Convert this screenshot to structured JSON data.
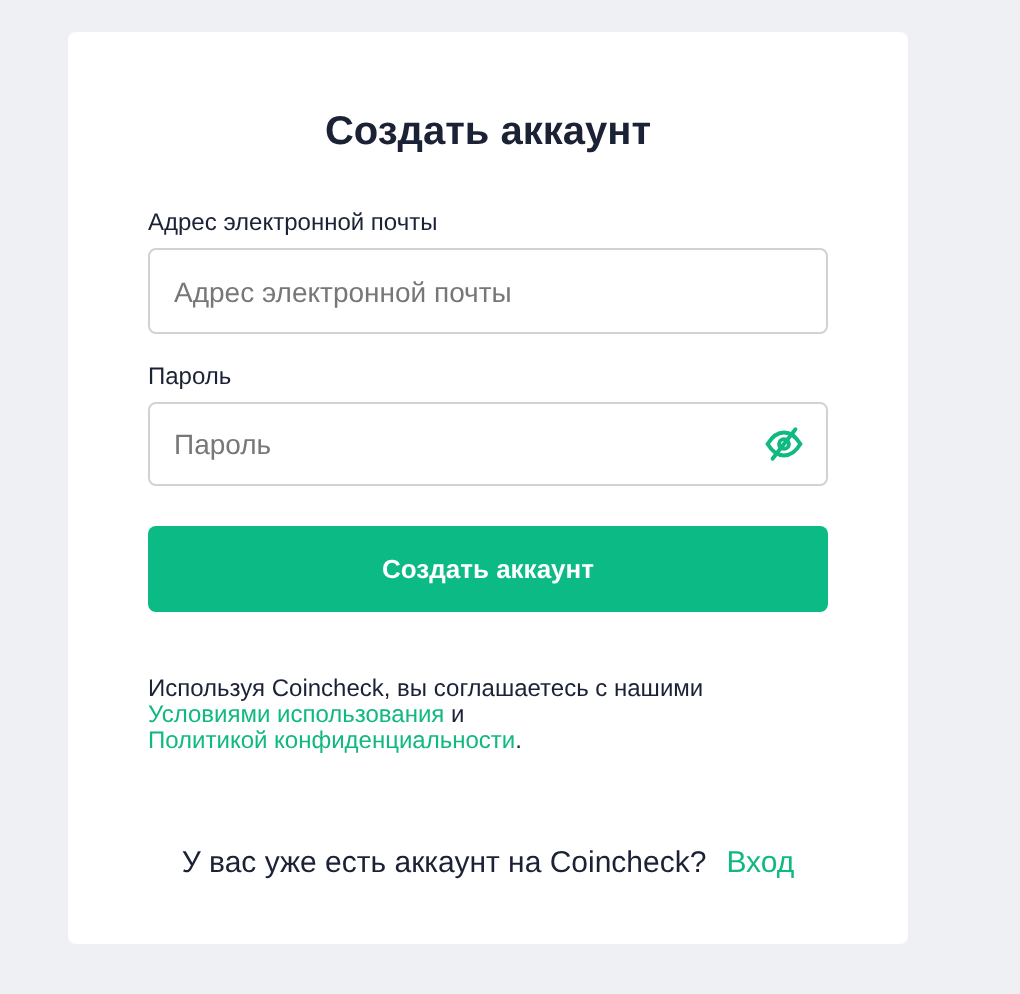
{
  "title": "Создать аккаунт",
  "fields": [
    {
      "label": "Адрес электронной почты",
      "placeholder": "Адрес электронной почты",
      "kind": "email"
    },
    {
      "label": "Пароль",
      "placeholder": "Пароль",
      "kind": "password"
    }
  ],
  "submit": "Создать аккаунт",
  "terms": {
    "prefix": "Используя Coincheck, вы соглашаетесь с нашими",
    "link_1": "Условиями использования",
    "middle": "и",
    "link_2": "Политикой конфиденциальности",
    "suffix": "."
  },
  "login": {
    "text": "У вас уже есть аккаунт на Coincheck?",
    "link": "Вход"
  }
}
